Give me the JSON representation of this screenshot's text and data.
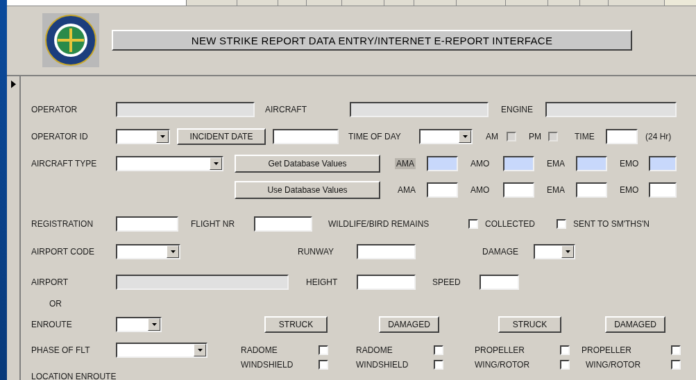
{
  "header": {
    "title": "NEW STRIKE REPORT DATA ENTRY/INTERNET E-REPORT INTERFACE"
  },
  "form": {
    "rows": [
      {
        "items": [
          {
            "kind": "label",
            "text": "OPERATOR"
          },
          {
            "kind": "field",
            "disabled": true
          },
          {
            "kind": "label",
            "text": "AIRCRAFT"
          },
          {
            "kind": "field",
            "disabled": true
          },
          {
            "kind": "label",
            "text": "ENGINE"
          },
          {
            "kind": "field",
            "disabled": true
          }
        ]
      },
      {
        "items": [
          {
            "kind": "label",
            "text": "OPERATOR ID"
          },
          {
            "kind": "combo"
          },
          {
            "kind": "button",
            "text": "INCIDENT DATE"
          },
          {
            "kind": "field",
            "disabled": false
          },
          {
            "kind": "label",
            "text": "TIME OF DAY"
          },
          {
            "kind": "combo"
          },
          {
            "kind": "label",
            "text": "AM"
          },
          {
            "kind": "check",
            "checked": false,
            "disabled": true
          },
          {
            "kind": "label",
            "text": "PM"
          },
          {
            "kind": "check",
            "checked": false,
            "disabled": true
          },
          {
            "kind": "label",
            "text": "TIME"
          },
          {
            "kind": "field",
            "disabled": false
          },
          {
            "kind": "label",
            "text": "(24 Hr)"
          }
        ]
      },
      {
        "items": [
          {
            "kind": "label",
            "text": "AIRCRAFT TYPE"
          },
          {
            "kind": "combo"
          },
          {
            "kind": "button",
            "text": "Get Database Values"
          },
          {
            "kind": "label",
            "text": "AMA",
            "highlighted": true
          },
          {
            "kind": "field",
            "disabled": false,
            "highlighted": true
          },
          {
            "kind": "label",
            "text": "AMO"
          },
          {
            "kind": "field",
            "disabled": false,
            "highlighted": true
          },
          {
            "kind": "label",
            "text": "EMA"
          },
          {
            "kind": "field",
            "disabled": false,
            "highlighted": true
          },
          {
            "kind": "label",
            "text": "EMO"
          },
          {
            "kind": "field",
            "disabled": false,
            "highlighted": true
          }
        ]
      },
      {
        "items": [
          {
            "kind": "button",
            "text": "Use Database Values"
          },
          {
            "kind": "label",
            "text": "AMA"
          },
          {
            "kind": "field",
            "disabled": false
          },
          {
            "kind": "label",
            "text": "AMO"
          },
          {
            "kind": "field",
            "disabled": false
          },
          {
            "kind": "label",
            "text": "EMA"
          },
          {
            "kind": "field",
            "disabled": false
          },
          {
            "kind": "label",
            "text": "EMO"
          },
          {
            "kind": "field",
            "disabled": false
          }
        ]
      },
      {
        "items": [
          {
            "kind": "label",
            "text": "REGISTRATION"
          },
          {
            "kind": "field",
            "disabled": false
          },
          {
            "kind": "label",
            "text": "FLIGHT NR"
          },
          {
            "kind": "field",
            "disabled": false
          },
          {
            "kind": "label",
            "text": "WILDLIFE/BIRD REMAINS"
          },
          {
            "kind": "check",
            "checked": false,
            "disabled": false
          },
          {
            "kind": "label",
            "text": "COLLECTED"
          },
          {
            "kind": "check",
            "checked": false,
            "disabled": false
          },
          {
            "kind": "label",
            "text": "SENT TO SM'THS'N"
          }
        ]
      },
      {
        "items": [
          {
            "kind": "label",
            "text": "AIRPORT CODE"
          },
          {
            "kind": "combo"
          },
          {
            "kind": "label",
            "text": "RUNWAY"
          },
          {
            "kind": "field",
            "disabled": false
          },
          {
            "kind": "label",
            "text": "DAMAGE"
          },
          {
            "kind": "combo"
          }
        ]
      },
      {
        "items": [
          {
            "kind": "label",
            "text": "AIRPORT"
          },
          {
            "kind": "field",
            "disabled": true
          },
          {
            "kind": "label",
            "text": "HEIGHT"
          },
          {
            "kind": "field",
            "disabled": false
          },
          {
            "kind": "label",
            "text": "SPEED"
          },
          {
            "kind": "field",
            "disabled": false
          }
        ]
      },
      {
        "items": [
          {
            "kind": "label",
            "text": "OR"
          }
        ]
      },
      {
        "items": [
          {
            "kind": "label",
            "text": "ENROUTE"
          },
          {
            "kind": "combo"
          },
          {
            "kind": "button",
            "text": "STRUCK"
          },
          {
            "kind": "button",
            "text": "DAMAGED"
          },
          {
            "kind": "button",
            "text": "STRUCK"
          },
          {
            "kind": "button",
            "text": "DAMAGED"
          }
        ]
      },
      {
        "items": [
          {
            "kind": "label",
            "text": "PHASE OF FLT"
          },
          {
            "kind": "combo"
          },
          {
            "kind": "label",
            "text": "RADOME"
          },
          {
            "kind": "check",
            "checked": false,
            "disabled": false
          },
          {
            "kind": "label",
            "text": "RADOME"
          },
          {
            "kind": "check",
            "checked": false,
            "disabled": false
          },
          {
            "kind": "label",
            "text": "PROPELLER"
          },
          {
            "kind": "check",
            "checked": false,
            "disabled": false
          },
          {
            "kind": "label",
            "text": "PROPELLER"
          },
          {
            "kind": "check",
            "checked": false,
            "disabled": false
          }
        ]
      },
      {
        "items": [
          {
            "kind": "label",
            "text": "WINDSHIELD"
          },
          {
            "kind": "check",
            "checked": false,
            "disabled": false
          },
          {
            "kind": "label",
            "text": "WINDSHIELD"
          },
          {
            "kind": "check",
            "checked": false,
            "disabled": false
          },
          {
            "kind": "label",
            "text": "WING/ROTOR"
          },
          {
            "kind": "check",
            "checked": false,
            "disabled": false
          },
          {
            "kind": "label",
            "text": "WING/ROTOR"
          },
          {
            "kind": "check",
            "checked": false,
            "disabled": false
          }
        ]
      },
      {
        "items": [
          {
            "kind": "label",
            "text": "LOCATION ENROUTE"
          }
        ]
      }
    ]
  }
}
